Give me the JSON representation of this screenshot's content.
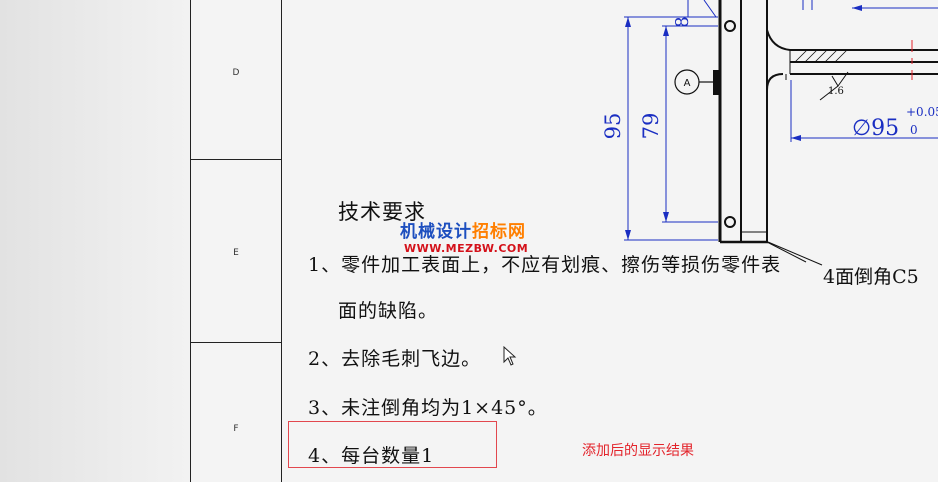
{
  "sheet": {
    "zone_labels": [
      "D",
      "E",
      "F"
    ]
  },
  "drawing": {
    "dimensions": {
      "d8": "8",
      "d95": "95",
      "d79": "79",
      "diameter": "∅95",
      "tol_upper": "+0.05",
      "tol_lower": "0",
      "roughness": "1.6",
      "datum": "A"
    },
    "chamfer_note": "4面倒角C5"
  },
  "technical_requirements": {
    "title": "技术要求",
    "items": [
      "1、零件加工表面上，不应有划痕、擦伤等损伤零件表",
      "面的缺陷。",
      "2、去除毛刺飞边。",
      "3、未注倒角均为1×45°。",
      "4、每台数量1"
    ]
  },
  "watermark": {
    "cn_part1": "机械设计",
    "cn_part2": "招标网",
    "url": "WWW.MEZBW.COM"
  },
  "annotation": {
    "result_note": "添加后的显示结果"
  },
  "colors": {
    "dimension_blue": "#1a2ec2",
    "annotation_red": "#e3242b",
    "outline_black": "#111111"
  }
}
